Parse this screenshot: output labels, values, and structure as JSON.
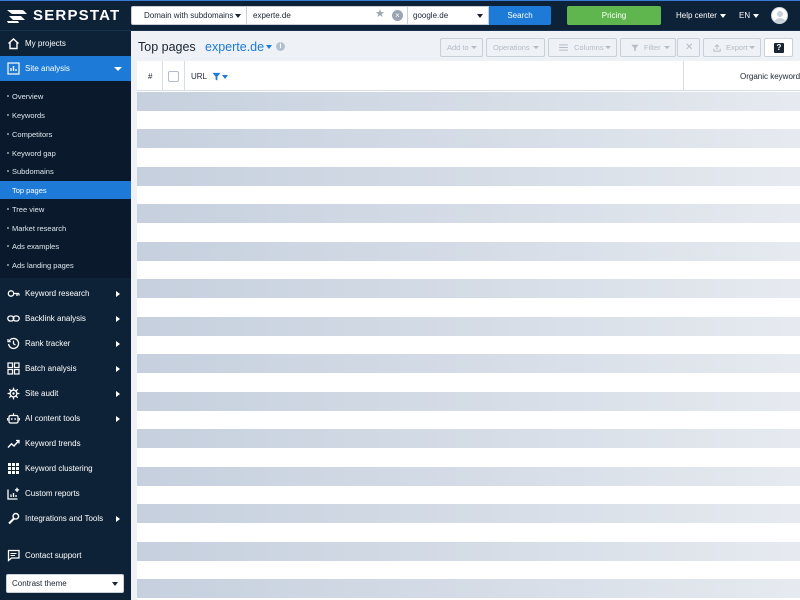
{
  "header": {
    "logo_text": "SERPSTAT",
    "search": {
      "scope": "Domain with subdomains",
      "domain_value": "experte.de",
      "engine": "google.de",
      "search_label": "Search"
    },
    "pricing_label": "Pricing",
    "help_center_label": "Help center",
    "language_label": "EN"
  },
  "sidebar": {
    "items": [
      {
        "label": "My projects",
        "icon": "house-icon"
      },
      {
        "label": "Site analysis",
        "icon": "chart-icon"
      },
      {
        "label": "Keyword research",
        "icon": "key-icon"
      },
      {
        "label": "Backlink analysis",
        "icon": "link-icon"
      },
      {
        "label": "Rank tracker",
        "icon": "history-icon"
      },
      {
        "label": "Batch analysis",
        "icon": "grid-icon"
      },
      {
        "label": "Site audit",
        "icon": "gear-icon"
      },
      {
        "label": "AI content tools",
        "icon": "robot-icon"
      },
      {
        "label": "Keyword trends",
        "icon": "trend-icon"
      },
      {
        "label": "Keyword clustering",
        "icon": "cluster-icon"
      },
      {
        "label": "Custom reports",
        "icon": "report-icon"
      },
      {
        "label": "Integrations and Tools",
        "icon": "wrench-icon"
      },
      {
        "label": "Contact support",
        "icon": "chat-icon"
      }
    ],
    "site_analysis_sub": [
      "Overview",
      "Keywords",
      "Competitors",
      "Keyword gap",
      "Subdomains",
      "Top pages",
      "Tree view",
      "Market research",
      "Ads examples",
      "Ads landing pages"
    ],
    "active_sub": "Top pages",
    "theme_label": "Contrast theme"
  },
  "main": {
    "title": "Top pages",
    "domain": "experte.de",
    "toolbar": {
      "add_to": "Add to",
      "operations": "Operations",
      "columns": "Columns",
      "filter": "Filter",
      "export": "Export",
      "help": "?"
    },
    "table": {
      "columns": [
        "#",
        "URL",
        "Organic keywords"
      ]
    }
  },
  "colors": {
    "nav_bg": "#0e2237",
    "accent": "#1d7bd7",
    "pricing": "#5fb64e"
  }
}
